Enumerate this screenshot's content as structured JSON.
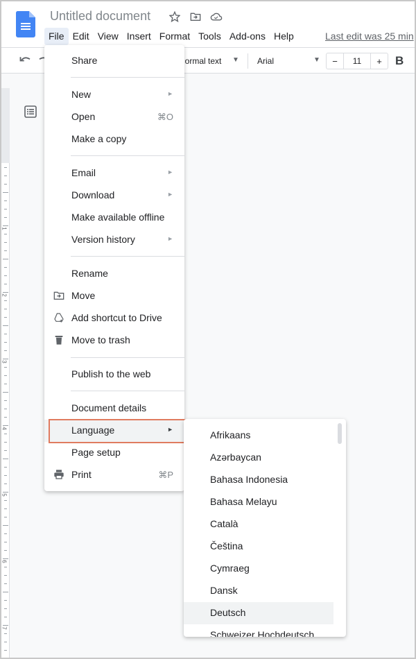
{
  "app": {
    "title": "Untitled document",
    "last_edit": "Last edit was 25 min"
  },
  "menubar": {
    "items": [
      "File",
      "Edit",
      "View",
      "Insert",
      "Format",
      "Tools",
      "Add-ons",
      "Help"
    ],
    "active": "File"
  },
  "toolbar": {
    "style": "Normal text",
    "font": "Arial",
    "font_size": "11",
    "minus": "−",
    "plus": "+",
    "bold": "B"
  },
  "ruler": {
    "numbers": [
      "1",
      "1",
      "2",
      "3",
      "4",
      "5",
      "6",
      "7"
    ]
  },
  "file_menu": {
    "items": [
      {
        "label": "Share"
      },
      {
        "label": "New",
        "submenu": true
      },
      {
        "label": "Open",
        "shortcut": "⌘O"
      },
      {
        "label": "Make a copy"
      },
      {
        "label": "Email",
        "submenu": true
      },
      {
        "label": "Download",
        "submenu": true
      },
      {
        "label": "Make available offline"
      },
      {
        "label": "Version history",
        "submenu": true
      },
      {
        "label": "Rename"
      },
      {
        "label": "Move",
        "icon": "folder-move-icon"
      },
      {
        "label": "Add shortcut to Drive",
        "icon": "drive-shortcut-icon"
      },
      {
        "label": "Move to trash",
        "icon": "trash-icon"
      },
      {
        "label": "Publish to the web"
      },
      {
        "label": "Document details"
      },
      {
        "label": "Language",
        "submenu": true,
        "highlighted": true
      },
      {
        "label": "Page setup"
      },
      {
        "label": "Print",
        "icon": "print-icon",
        "shortcut": "⌘P"
      }
    ],
    "arrow": "►"
  },
  "language_menu": {
    "items": [
      "Afrikaans",
      "Azərbaycan",
      "Bahasa Indonesia",
      "Bahasa Melayu",
      "Català",
      "Čeština",
      "Cymraeg",
      "Dansk",
      "Deutsch",
      "Schweizer Hochdeutsch"
    ],
    "hovered": "Deutsch"
  },
  "colors": {
    "highlight_border": "#e07b5f",
    "docs_blue": "#4285f4"
  }
}
